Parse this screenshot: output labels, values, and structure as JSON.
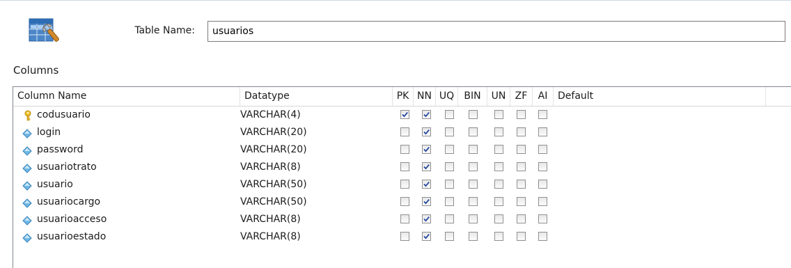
{
  "table_name": {
    "label": "Table Name:",
    "value": "usuarios",
    "icon": "table-edit-icon"
  },
  "section_label": "Columns",
  "grid": {
    "headers": {
      "column_name": "Column Name",
      "datatype": "Datatype",
      "pk": "PK",
      "nn": "NN",
      "uq": "UQ",
      "bin": "BIN",
      "un": "UN",
      "zf": "ZF",
      "ai": "AI",
      "default": "Default"
    },
    "rows": [
      {
        "icon": "key-icon",
        "name": "codusuario",
        "datatype": "VARCHAR(4)",
        "pk": true,
        "nn": true,
        "uq": false,
        "bin": false,
        "un": false,
        "zf": false,
        "ai": false
      },
      {
        "icon": "column-diamond-icon",
        "name": "login",
        "datatype": "VARCHAR(20)",
        "pk": false,
        "nn": true,
        "uq": false,
        "bin": false,
        "un": false,
        "zf": false,
        "ai": false
      },
      {
        "icon": "column-diamond-icon",
        "name": "password",
        "datatype": "VARCHAR(20)",
        "pk": false,
        "nn": true,
        "uq": false,
        "bin": false,
        "un": false,
        "zf": false,
        "ai": false
      },
      {
        "icon": "column-diamond-icon",
        "name": "usuariotrato",
        "datatype": "VARCHAR(8)",
        "pk": false,
        "nn": true,
        "uq": false,
        "bin": false,
        "un": false,
        "zf": false,
        "ai": false
      },
      {
        "icon": "column-diamond-icon",
        "name": "usuario",
        "datatype": "VARCHAR(50)",
        "pk": false,
        "nn": true,
        "uq": false,
        "bin": false,
        "un": false,
        "zf": false,
        "ai": false
      },
      {
        "icon": "column-diamond-icon",
        "name": "usuariocargo",
        "datatype": "VARCHAR(50)",
        "pk": false,
        "nn": true,
        "uq": false,
        "bin": false,
        "un": false,
        "zf": false,
        "ai": false
      },
      {
        "icon": "column-diamond-icon",
        "name": "usuarioacceso",
        "datatype": "VARCHAR(8)",
        "pk": false,
        "nn": true,
        "uq": false,
        "bin": false,
        "un": false,
        "zf": false,
        "ai": false
      },
      {
        "icon": "column-diamond-icon",
        "name": "usuarioestado",
        "datatype": "VARCHAR(8)",
        "pk": false,
        "nn": true,
        "uq": false,
        "bin": false,
        "un": false,
        "zf": false,
        "ai": false
      }
    ]
  }
}
